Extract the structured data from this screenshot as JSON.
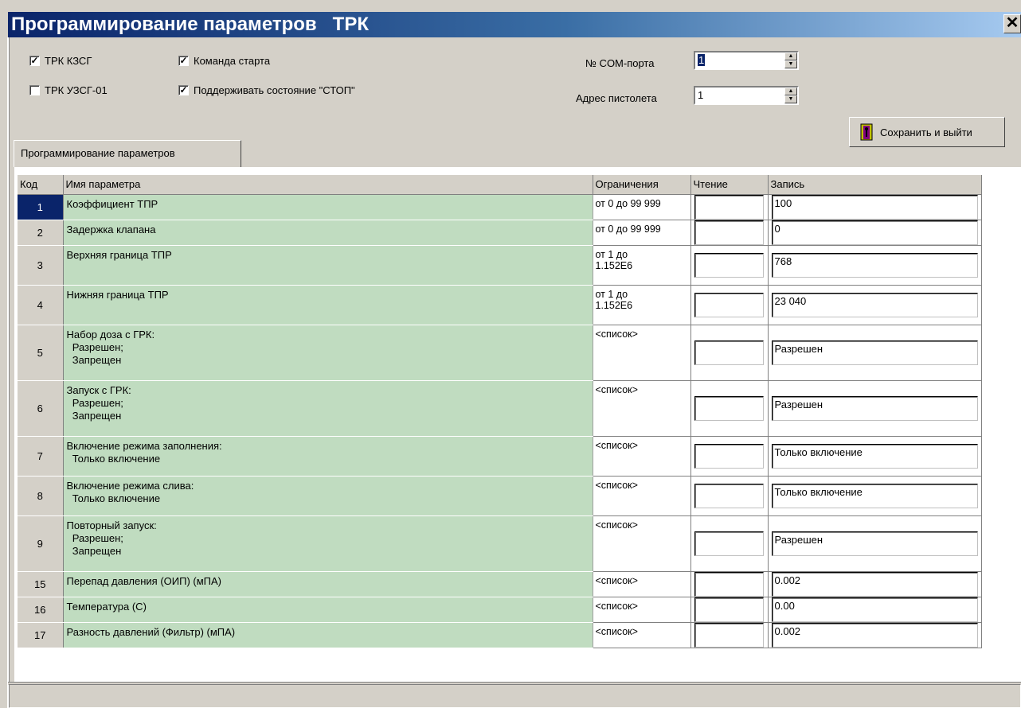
{
  "window": {
    "title": "Программирование параметров   ТРК",
    "close_label": "✕"
  },
  "options": {
    "trk_kzsg": {
      "label": "ТРК КЗСГ",
      "checked": true
    },
    "trk_uzsg": {
      "label": "ТРК УЗСГ-01",
      "checked": false
    },
    "start_cmd": {
      "label": "Команда старта",
      "checked": true
    },
    "stop_state": {
      "label": "Поддерживать состояние \"СТОП\"",
      "checked": true
    }
  },
  "com_port": {
    "label": "№ COM-порта",
    "value": "1"
  },
  "gun_address": {
    "label": "Адрес пистолета",
    "value": "1"
  },
  "save_button": {
    "label": "Сохранить и выйти",
    "icon": "exit-door-icon"
  },
  "tab": {
    "label": "Программирование параметров"
  },
  "table": {
    "headers": {
      "code": "Код",
      "name": "Имя параметра",
      "limits": "Ограничения",
      "read": "Чтение",
      "write": "Запись"
    },
    "rows": [
      {
        "code": "1",
        "name": "Коэффициент ТПР",
        "limits": "от 0 до 99 999",
        "read": "",
        "write": "100"
      },
      {
        "code": "2",
        "name": "Задержка клапана",
        "limits": "от 0 до 99 999",
        "read": "",
        "write": "0"
      },
      {
        "code": "3",
        "name": "Верхняя граница ТПР",
        "limits": "от 1 до\n1.152E6",
        "read": "",
        "write": "768"
      },
      {
        "code": "4",
        "name": "Нижняя граница ТПР",
        "limits": "от 1 до\n1.152E6",
        "read": "",
        "write": "23 040"
      },
      {
        "code": "5",
        "name": "Набор доза с ГРК:\n  Разрешен;\n  Запрещен",
        "limits": "<список>",
        "read": "",
        "write": "Разрешен"
      },
      {
        "code": "6",
        "name": "Запуск с ГРК:\n  Разрешен;\n  Запрещен",
        "limits": "<список>",
        "read": "",
        "write": "Разрешен"
      },
      {
        "code": "7",
        "name": "Включение режима заполнения:\n  Только включение",
        "limits": "<список>",
        "read": "",
        "write": "Только включение"
      },
      {
        "code": "8",
        "name": "Включение режима слива:\n  Только включение",
        "limits": "<список>",
        "read": "",
        "write": "Только включение"
      },
      {
        "code": "9",
        "name": "Повторный запуск:\n  Разрешен;\n  Запрещен",
        "limits": "<список>",
        "read": "",
        "write": "Разрешен"
      },
      {
        "code": "15",
        "name": "Перепад давления (ОИП) (мПА)",
        "limits": "<список>",
        "read": "",
        "write": "0.002"
      },
      {
        "code": "16",
        "name": "Температура (С)",
        "limits": "<список>",
        "read": "",
        "write": "0.00"
      },
      {
        "code": "17",
        "name": "Разность давлений (Фильтр) (мПА)",
        "limits": "<список>",
        "read": "",
        "write": "0.002"
      }
    ],
    "selected_code": "1"
  },
  "colors": {
    "title_start": "#0a246a",
    "name_cell_bg": "#c0dcc0",
    "selection": "#0a246a"
  }
}
